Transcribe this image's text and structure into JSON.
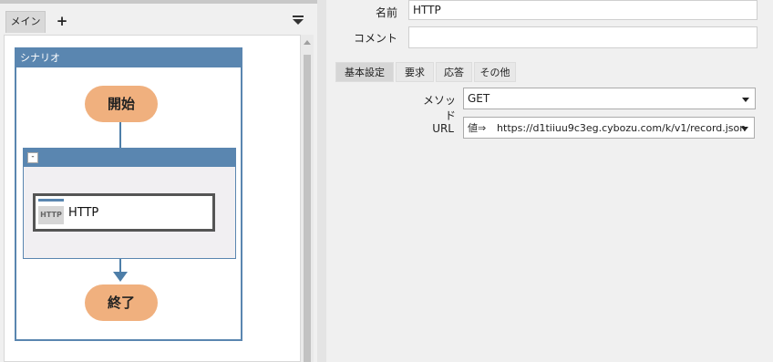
{
  "left": {
    "tabs": {
      "main": "メイン",
      "add": "+"
    },
    "scenario": {
      "title": "シナリオ",
      "start": "開始",
      "end": "終了",
      "group": {
        "collapse": "-"
      },
      "http_block": {
        "icon": "HTTP",
        "label": "HTTP"
      }
    }
  },
  "right": {
    "name": {
      "label": "名前",
      "value": "HTTP"
    },
    "comment": {
      "label": "コメント",
      "value": ""
    },
    "tabs": [
      "基本設定",
      "要求",
      "応答",
      "その他"
    ],
    "method": {
      "label": "メソッド",
      "value": "GET"
    },
    "url": {
      "label": "URL",
      "prefix": "値⇒",
      "value": "https://d1tiiuu9c3eg.cybozu.com/k/v1/record.json"
    }
  },
  "colors": {
    "accent": "#5a86b0",
    "node_fill": "#f0b07e",
    "panel_bg": "#f0f0f0"
  }
}
